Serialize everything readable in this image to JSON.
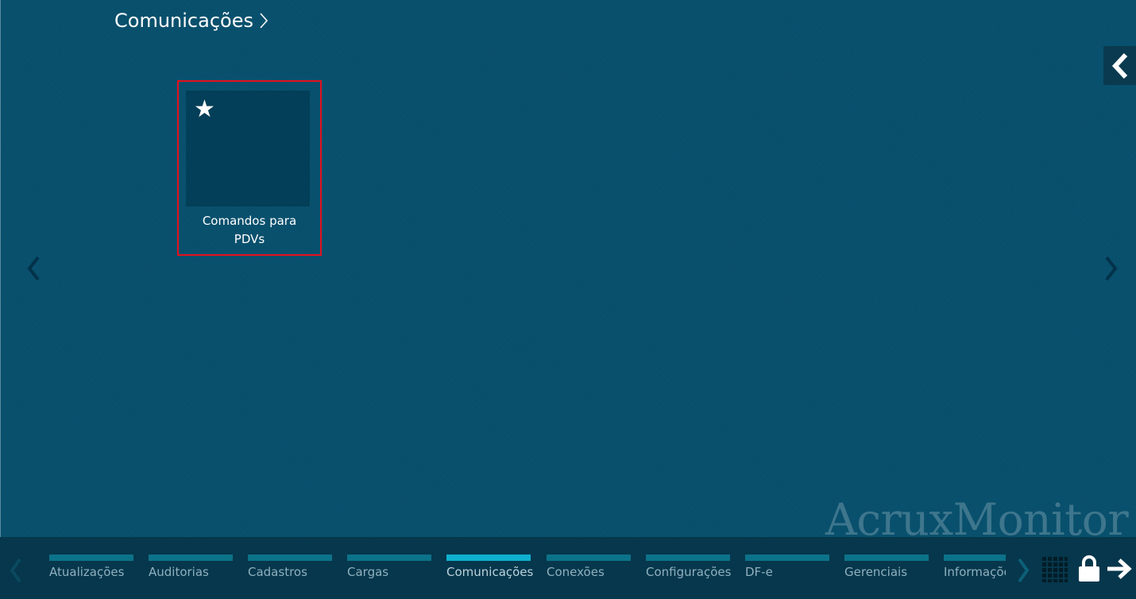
{
  "header": {
    "title": "Comunicações",
    "title_icon": "chevron-right-icon"
  },
  "side_toggle": {
    "icon": "chevron-left-icon"
  },
  "tiles": [
    {
      "label_line1": "Comandos para",
      "label_line2": "PDVs",
      "icon": "star-icon",
      "selected": true
    }
  ],
  "paging": {
    "prev_icon": "chevron-left-icon",
    "next_icon": "chevron-right-icon"
  },
  "brand": {
    "text": "AcruxMonitor"
  },
  "bottom_bar": {
    "tabs": [
      {
        "label": "Atualizações"
      },
      {
        "label": "Auditorias"
      },
      {
        "label": "Cadastros"
      },
      {
        "label": "Cargas"
      },
      {
        "label": "Comunicações",
        "active": true
      },
      {
        "label": "Conexões"
      },
      {
        "label": "Configurações"
      },
      {
        "label": "DF-e"
      },
      {
        "label": "Gerenciais"
      },
      {
        "label": "Informações"
      }
    ],
    "icons": [
      "chevron-left-icon",
      "chevron-right-icon",
      "grid-icon",
      "lock-icon",
      "arrow-right-icon"
    ]
  },
  "colors": {
    "background": "#07506d",
    "tile": "#033f58",
    "selection_border": "#e5101d",
    "tab_bar": "#0c7289",
    "tab_bar_active": "#0fb0cf",
    "bottom_bar": "#06374c"
  }
}
